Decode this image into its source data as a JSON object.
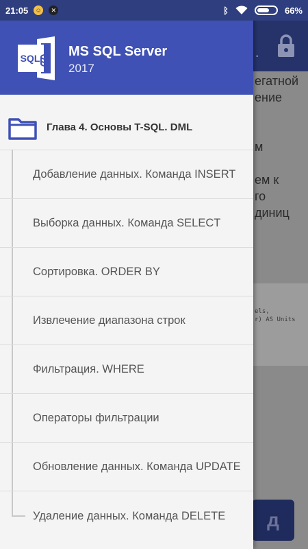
{
  "status_bar": {
    "time": "21:05",
    "battery": "66%",
    "battery_level": 0.66
  },
  "drawer": {
    "app_title": "MS SQL Server",
    "app_version": "2017",
    "logo_text": "SQL",
    "chapter": "Глава 4. Основы T-SQL. DML",
    "items": [
      "Добавление данных. Команда INSERT",
      "Выборка данных. Команда SELECT",
      "Сортировка. ORDER BY",
      "Извлечение диапазона строк",
      "Фильтрация. WHERE",
      "Операторы фильтрации",
      "Обновление данных. Команда UPDATE",
      "Удаление данных. Команда DELETE"
    ]
  },
  "background": {
    "text_lines": [
      "егатной",
      "ение",
      "",
      "",
      "м",
      "",
      "ем к",
      "го",
      "диниц"
    ],
    "code_lines": [
      "els,",
      "r) AS Units"
    ],
    "button_text": "д",
    "colors": {
      "primary": "#3f51b5",
      "primary_dark": "#2e3e7f"
    }
  }
}
